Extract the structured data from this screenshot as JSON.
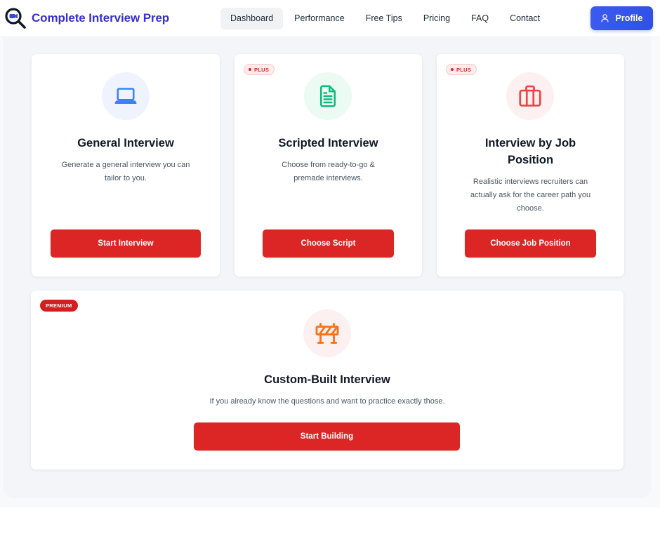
{
  "header": {
    "brand_title": "Complete Interview Prep",
    "logo_icon": "magnifier-camera-icon",
    "nav": [
      {
        "label": "Dashboard",
        "active": true
      },
      {
        "label": "Performance",
        "active": false
      },
      {
        "label": "Free Tips",
        "active": false
      },
      {
        "label": "Pricing",
        "active": false
      },
      {
        "label": "FAQ",
        "active": false
      },
      {
        "label": "Contact",
        "active": false
      }
    ],
    "profile_label": "Profile",
    "profile_icon": "user-icon"
  },
  "cards": [
    {
      "title": "General Interview",
      "description": "Generate a general interview you can tailor to you.",
      "button": "Start Interview",
      "icon": "laptop-icon",
      "icon_color": "#3b82f6",
      "icon_bg": "#eef3fd",
      "badge": null
    },
    {
      "title": "Scripted Interview",
      "description": "Choose from ready-to-go & premade interviews.",
      "button": "Choose Script",
      "icon": "document-icon",
      "icon_color": "#10b981",
      "icon_bg": "#ebfaf3",
      "badge": "PLUS"
    },
    {
      "title": "Interview by Job Position",
      "description": "Realistic interviews recruiters can actually ask for the career path you choose.",
      "button": "Choose Job Position",
      "icon": "briefcase-icon",
      "icon_color": "#ef4444",
      "icon_bg": "#fdf0f0",
      "badge": "PLUS"
    }
  ],
  "custom_card": {
    "badge": "PREMIUM",
    "title": "Custom-Built Interview",
    "description": "If you already know the questions and want to practice exactly those.",
    "button": "Start Building",
    "icon": "construction-barrier-icon",
    "icon_color": "#f97316",
    "icon_bg": "#fdf0f1"
  },
  "colors": {
    "brand": "#3730c9",
    "primary_button": "#dc2626",
    "profile_button": "#3b5bf0"
  }
}
